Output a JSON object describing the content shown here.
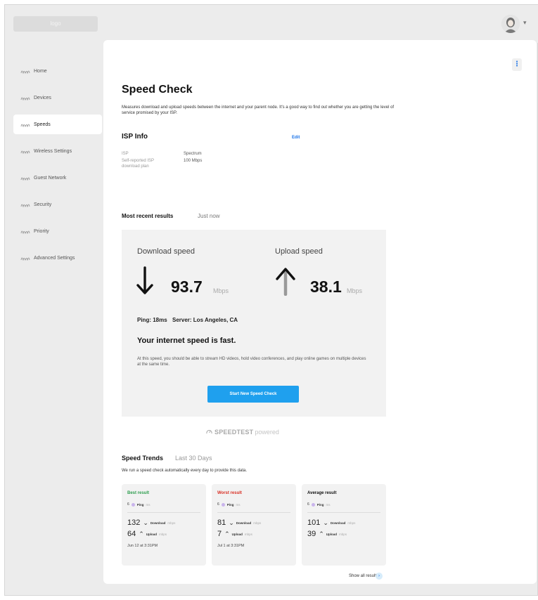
{
  "header": {
    "logo_text": "logo"
  },
  "sidebar": {
    "items": [
      {
        "label": "Home"
      },
      {
        "label": "Devices"
      },
      {
        "label": "Speeds"
      },
      {
        "label": "Wireless Settings"
      },
      {
        "label": "Guest Network"
      },
      {
        "label": "Security"
      },
      {
        "label": "Priority"
      },
      {
        "label": "Advanced Settings"
      }
    ],
    "active": "Speeds"
  },
  "page": {
    "title": "Speed Check",
    "description": "Measures download and upload speeds between the internet and your parent node. It's a good way to find out whether you are getting the level of service promised by your ISP.",
    "menu_glyph": "⋮"
  },
  "isp": {
    "title": "ISP Info",
    "edit_label": "Edit",
    "isp_key": "ISP",
    "isp_value": "Spectrum",
    "plan_key": "Self-reported ISP download plan",
    "plan_value": "100 Mbps"
  },
  "recent": {
    "title": "Most recent results",
    "time": "Just now",
    "download_label": "Download speed",
    "download_value": "93.7",
    "download_unit": "Mbps",
    "upload_label": "Upload speed",
    "upload_value": "38.1",
    "upload_unit": "Mbps",
    "ping": "Ping: 18ms",
    "server": "Server: Los Angeles, CA",
    "verdict": "Your internet speed is fast.",
    "verdict_desc": "At this speed, you should be able to stream HD videos, hold video conferences, and play online games on multiple devices at the same time.",
    "button_label": "Start New Speed Check"
  },
  "speedtest": {
    "brand": "SPEEDTEST",
    "suffix": "powered"
  },
  "trends": {
    "title": "Speed Trends",
    "range": "Last 30 Days",
    "description": "We run a speed check automatically every day to provide this data.",
    "cards": [
      {
        "title": "Best result",
        "title_color": "#2e9e4f",
        "ping_value": "6",
        "ping_label": "Ping",
        "ping_unit": "ms",
        "download": "132",
        "download_label": "Download",
        "download_unit": "mbps",
        "upload": "64",
        "upload_label": "Upload",
        "upload_unit": "mbps",
        "date": "Jun 12 at 3:31PM"
      },
      {
        "title": "Worst result",
        "title_color": "#d93025",
        "ping_value": "6",
        "ping_label": "Ping",
        "ping_unit": "ms",
        "download": "81",
        "download_label": "Download",
        "download_unit": "mbps",
        "upload": "7",
        "upload_label": "Upload",
        "upload_unit": "mbps",
        "date": "Jul 1 at 3:31PM"
      },
      {
        "title": "Average result",
        "title_color": "#111111",
        "ping_value": "6",
        "ping_label": "Ping",
        "ping_unit": "ms",
        "download": "101",
        "download_label": "Download",
        "download_unit": "mbps",
        "upload": "39",
        "upload_label": "Upload",
        "upload_unit": "mbps",
        "date": ""
      }
    ],
    "show_all": "Show all results",
    "show_all_icon": "›"
  },
  "colors": {
    "accent": "#1fa0ee",
    "panel": "#f2f2f2",
    "background": "#ececec"
  }
}
